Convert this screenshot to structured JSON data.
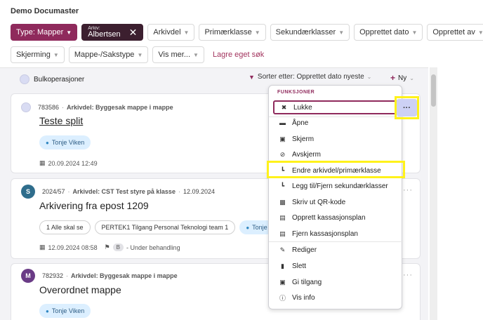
{
  "app": {
    "title": "Demo Documaster"
  },
  "filters": {
    "row1": [
      {
        "label": "Type: Mapper",
        "kind": "type"
      },
      {
        "label_small": "Arkiv:",
        "label": "Albertsen",
        "kind": "arkiv"
      },
      {
        "label": "Arkivdel"
      },
      {
        "label": "Primærklasse"
      },
      {
        "label": "Sekundærklasser"
      },
      {
        "label": "Opprettet dato"
      },
      {
        "label": "Opprettet av"
      }
    ],
    "row2": [
      {
        "label": "Skjerming"
      },
      {
        "label": "Mappe-/Sakstype"
      },
      {
        "label": "Vis mer..."
      }
    ],
    "save_search": "Lagre eget søk"
  },
  "toolbar": {
    "bulk": "Bulkoperasjoner",
    "sort": "Sorter etter: Opprettet dato nyeste",
    "new": "Ny"
  },
  "cards": [
    {
      "id": "783586",
      "arkivdel": "Arkivdel: Byggesak mappe i mappe",
      "title": "Teste split",
      "person": "Tonje Viken",
      "date": "20.09.2024 12:49"
    },
    {
      "avatar": "S",
      "id": "2024/57",
      "arkivdel": "Arkivdel: CST Test styre på klasse",
      "created": "12.09.2024",
      "title": "Arkivering fra epost 1209",
      "tags": [
        "1 Alle skal se",
        "PERTEK1 Tilgang Personal Teknologi team 1"
      ],
      "person": "Tonje",
      "date": "12.09.2024 08:58",
      "status_badge": "B",
      "status": "- Under behandling"
    },
    {
      "avatar": "M",
      "id": "782932",
      "arkivdel": "Arkivdel: Byggesak mappe i mappe",
      "title": "Overordnet mappe",
      "person": "Tonje Viken"
    }
  ],
  "menu": {
    "header": "FUNKSJONER",
    "items": [
      {
        "label": "Lukke",
        "icon": "close-circle-icon"
      },
      {
        "label": "Åpne",
        "icon": "folder-icon"
      },
      {
        "label": "Skjerm",
        "icon": "lock-icon"
      },
      {
        "label": "Avskjerm",
        "icon": "unlock-icon"
      },
      {
        "label": "Endre arkivdel/primærklasse",
        "icon": "hierarchy-icon"
      },
      {
        "label": "Legg til/Fjern sekundærklasser",
        "icon": "hierarchy-icon"
      },
      {
        "label": "Skriv ut QR-kode",
        "icon": "qr-icon"
      },
      {
        "label": "Opprett kassasjonsplan",
        "icon": "plan-icon"
      },
      {
        "label": "Fjern kassasjonsplan",
        "icon": "plan-remove-icon"
      },
      {
        "label": "Rediger",
        "icon": "pencil-icon"
      },
      {
        "label": "Slett",
        "icon": "trash-icon"
      },
      {
        "label": "Gi tilgang",
        "icon": "unlock-icon"
      },
      {
        "label": "Vis info",
        "icon": "info-icon"
      }
    ]
  },
  "colors": {
    "brand": "#8f2a5c",
    "highlight": "#fff21b",
    "pill": "#dcefff"
  }
}
